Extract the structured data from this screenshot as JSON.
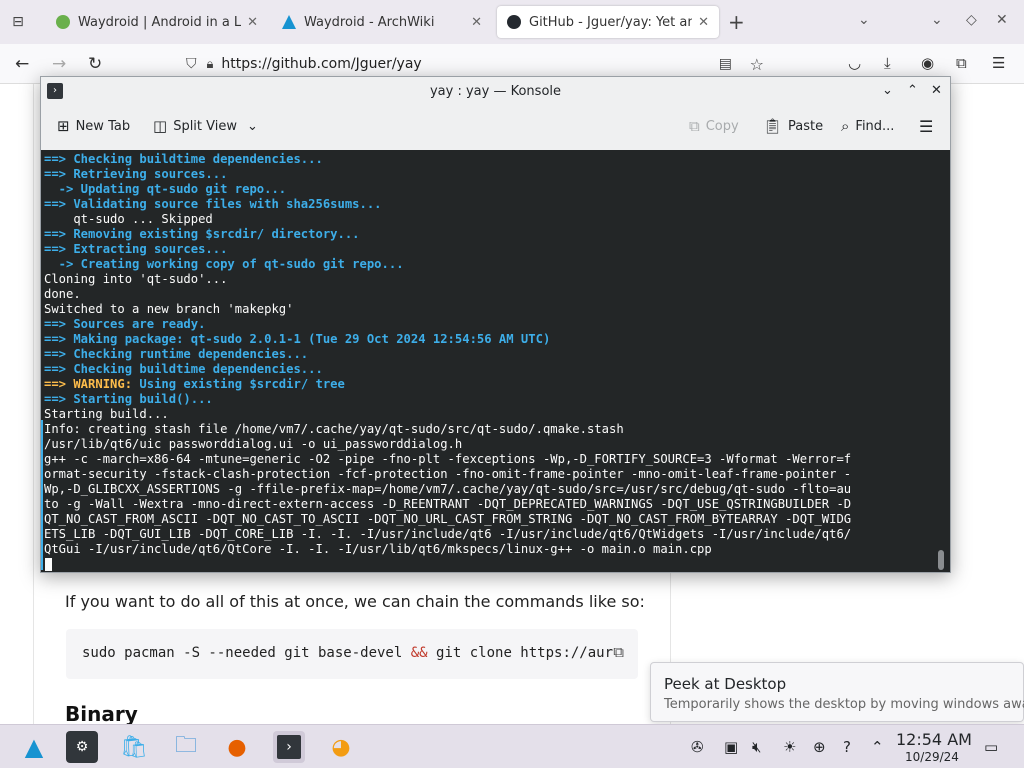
{
  "browser": {
    "tabs": [
      {
        "title": "Waydroid | Android in a Li",
        "favicon_color": "#6ab04c"
      },
      {
        "title": "Waydroid - ArchWiki",
        "favicon_color": "#1793d1"
      },
      {
        "title": "GitHub - Jguer/yay: Yet ano",
        "favicon_color": "#24292f",
        "active": true
      }
    ],
    "url": "https://github.com/Jguer/yay"
  },
  "page": {
    "text": "If you want to do all of this at once, we can chain the commands like so:",
    "code_before": "sudo pacman -S --needed git base-devel ",
    "code_amp": "&&",
    "code_after": " git clone https://aur",
    "heading": "Binary"
  },
  "konsole": {
    "title": "yay : yay — Konsole",
    "toolbar": {
      "new_tab": "New Tab",
      "split_view": "Split View",
      "copy": "Copy",
      "paste": "Paste",
      "find": "Find..."
    },
    "lines": [
      [
        {
          "c": "b",
          "t": "==> Checking buildtime dependencies..."
        }
      ],
      [
        {
          "c": "b",
          "t": "==> Retrieving sources..."
        }
      ],
      [
        {
          "c": "b",
          "t": "  -> Updating qt-sudo git repo..."
        }
      ],
      [
        {
          "c": "b",
          "t": "==> Validating source files with sha256sums..."
        }
      ],
      [
        {
          "c": "w",
          "t": "    qt-sudo ... Skipped"
        }
      ],
      [
        {
          "c": "b",
          "t": "==> Removing existing $srcdir/ directory..."
        }
      ],
      [
        {
          "c": "b",
          "t": "==> Extracting sources..."
        }
      ],
      [
        {
          "c": "b",
          "t": "  -> Creating working copy of qt-sudo git repo..."
        }
      ],
      [
        {
          "c": "w",
          "t": "Cloning into 'qt-sudo'..."
        }
      ],
      [
        {
          "c": "w",
          "t": "done."
        }
      ],
      [
        {
          "c": "w",
          "t": "Switched to a new branch 'makepkg'"
        }
      ],
      [
        {
          "c": "b",
          "t": "==> Sources are ready."
        }
      ],
      [
        {
          "c": "b",
          "t": "==> Making package: qt-sudo 2.0.1-1 (Tue 29 Oct 2024 12:54:56 AM UTC)"
        }
      ],
      [
        {
          "c": "b",
          "t": "==> Checking runtime dependencies..."
        }
      ],
      [
        {
          "c": "b",
          "t": "==> Checking buildtime dependencies..."
        }
      ],
      [
        {
          "c": "y",
          "t": "==> WARNING:"
        },
        {
          "c": "b",
          "t": " Using existing $srcdir/ tree"
        }
      ],
      [
        {
          "c": "b",
          "t": "==> Starting build()..."
        }
      ],
      [
        {
          "c": "w",
          "t": "Starting build..."
        }
      ],
      [
        {
          "c": "w",
          "t": "Info: creating stash file /home/vm7/.cache/yay/qt-sudo/src/qt-sudo/.qmake.stash"
        }
      ],
      [
        {
          "c": "w",
          "t": "/usr/lib/qt6/uic passworddialog.ui -o ui_passworddialog.h"
        }
      ],
      [
        {
          "c": "w",
          "t": "g++ -c -march=x86-64 -mtune=generic -O2 -pipe -fno-plt -fexceptions -Wp,-D_FORTIFY_SOURCE=3 -Wformat -Werror=f"
        }
      ],
      [
        {
          "c": "w",
          "t": "ormat-security -fstack-clash-protection -fcf-protection -fno-omit-frame-pointer -mno-omit-leaf-frame-pointer -"
        }
      ],
      [
        {
          "c": "w",
          "t": "Wp,-D_GLIBCXX_ASSERTIONS -g -ffile-prefix-map=/home/vm7/.cache/yay/qt-sudo/src=/usr/src/debug/qt-sudo -flto=au"
        }
      ],
      [
        {
          "c": "w",
          "t": "to -g -Wall -Wextra -mno-direct-extern-access -D_REENTRANT -DQT_DEPRECATED_WARNINGS -DQT_USE_QSTRINGBUILDER -D"
        }
      ],
      [
        {
          "c": "w",
          "t": "QT_NO_CAST_FROM_ASCII -DQT_NO_CAST_TO_ASCII -DQT_NO_URL_CAST_FROM_STRING -DQT_NO_CAST_FROM_BYTEARRAY -DQT_WIDG"
        }
      ],
      [
        {
          "c": "w",
          "t": "ETS_LIB -DQT_GUI_LIB -DQT_CORE_LIB -I. -I. -I/usr/include/qt6 -I/usr/include/qt6/QtWidgets -I/usr/include/qt6/"
        }
      ],
      [
        {
          "c": "w",
          "t": "QtGui -I/usr/include/qt6/QtCore -I. -I. -I/usr/lib/qt6/mkspecs/linux-g++ -o main.o main.cpp"
        }
      ]
    ]
  },
  "taskbar": {
    "time": "12:54 AM",
    "date": "10/29/24"
  },
  "tooltip": {
    "title": "Peek at Desktop",
    "description": "Temporarily shows the desktop by moving windows away"
  }
}
